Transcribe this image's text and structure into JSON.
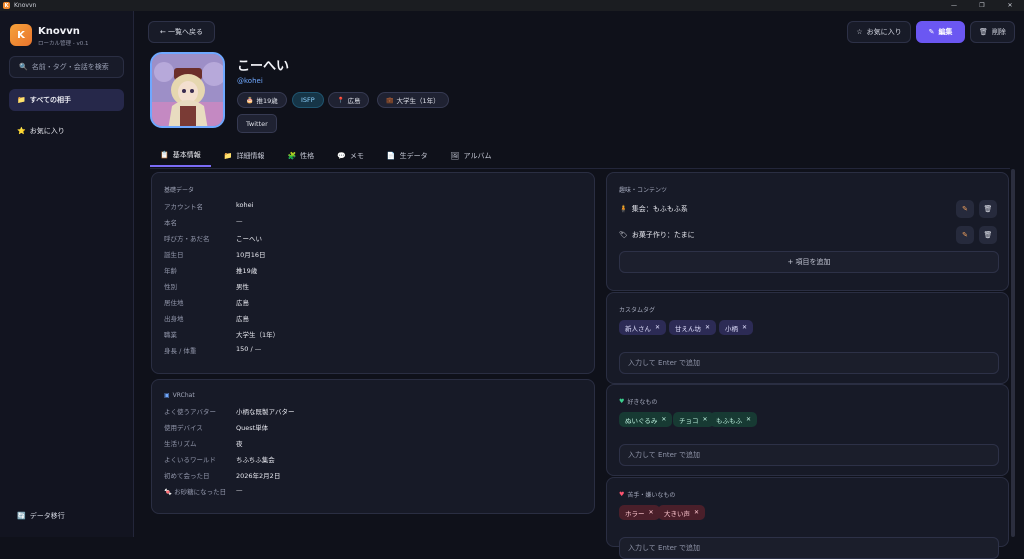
{
  "window": {
    "title": "Knovvn",
    "app_icon_letter": "K"
  },
  "sidebar": {
    "logo_letter": "K",
    "app_name": "Knovvn",
    "app_sub": "ローカル管理 - v0.1",
    "search_placeholder": "名前・タグ・会話を検索",
    "items": [
      {
        "label": "すべての相手",
        "icon": "folder-icon"
      },
      {
        "label": "お気に入り",
        "icon": "star-icon"
      }
    ],
    "migrate_label": "データ移行"
  },
  "header": {
    "back_label": "← 一覧へ戻る",
    "fav_label": "お気に入り",
    "edit_label": "編集",
    "delete_label": "削除"
  },
  "profile": {
    "name": "こーへい",
    "handle": "@kohei",
    "chips": [
      "推19歳",
      "ISFP",
      "広島",
      "大学生（1年）"
    ],
    "twitter_label": "Twitter"
  },
  "tabs": [
    {
      "label": "基本情報",
      "icon": "clipboard-icon"
    },
    {
      "label": "詳細情報",
      "icon": "folder-icon"
    },
    {
      "label": "性格",
      "icon": "puzzle-icon"
    },
    {
      "label": "メモ",
      "icon": "speech-icon"
    },
    {
      "label": "生データ",
      "icon": "page-icon"
    },
    {
      "label": "アルバム",
      "icon": "picture-icon"
    }
  ],
  "basic": {
    "title": "基礎データ",
    "rows": [
      {
        "label": "アカウント名",
        "value": "kohei"
      },
      {
        "label": "本名",
        "value": "—"
      },
      {
        "label": "呼び方・あだ名",
        "value": "こーへい"
      },
      {
        "label": "誕生日",
        "value": "10月16日"
      },
      {
        "label": "年齢",
        "value": "推19歳"
      },
      {
        "label": "性別",
        "value": "男性"
      },
      {
        "label": "居住地",
        "value": "広島"
      },
      {
        "label": "出身地",
        "value": "広島"
      },
      {
        "label": "職業",
        "value": "大学生（1年）"
      },
      {
        "label": "身長 / 体重",
        "value": "150 / —"
      }
    ]
  },
  "vrchat": {
    "title": "VRChat",
    "rows": [
      {
        "label": "よく使うアバター",
        "value": "小柄な既製アバター"
      },
      {
        "label": "使用デバイス",
        "value": "Quest単体"
      },
      {
        "label": "生活リズム",
        "value": "夜"
      },
      {
        "label": "よくいるワールド",
        "value": "ちふちふ集会"
      },
      {
        "label": "初めて会った日",
        "value": "2026年2月2日"
      },
      {
        "label": "お砂糖になった日",
        "value": "—"
      }
    ]
  },
  "hobbies": {
    "title": "趣味・コンテンツ",
    "items": [
      "集会：もふもふ系",
      "お菓子作り：たまに"
    ],
    "add_label": "+ 項目を追加"
  },
  "custom_tags": {
    "title": "カスタムタグ",
    "tags": [
      "新人さん",
      "甘えん坊",
      "小柄"
    ],
    "placeholder": "入力して Enter で追加"
  },
  "likes": {
    "title": "好きなもの",
    "tags": [
      "ぬいぐるみ",
      "チョコ",
      "もふもふ"
    ],
    "placeholder": "入力して Enter で追加"
  },
  "dislikes": {
    "title": "苦手・嫌いなもの",
    "tags": [
      "ホラー",
      "大きい声"
    ],
    "placeholder": "入力して Enter で追加"
  }
}
